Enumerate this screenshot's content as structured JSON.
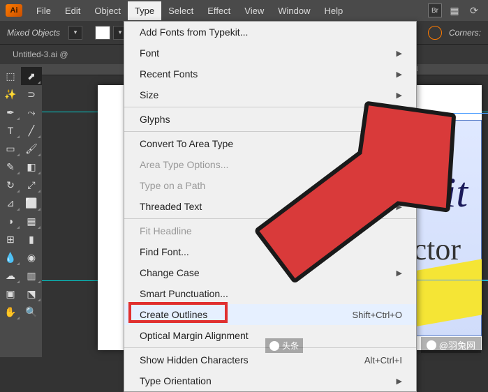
{
  "app": {
    "logo": "Ai"
  },
  "menubar": {
    "items": [
      "File",
      "Edit",
      "Object",
      "Type",
      "Select",
      "Effect",
      "View",
      "Window",
      "Help"
    ],
    "active_index": 3,
    "right": {
      "br": "Br"
    }
  },
  "optionsbar": {
    "label": "Mixed Objects",
    "corners": "Corners:"
  },
  "doctab": {
    "title": "Untitled-3.ai @"
  },
  "ruler": {
    "mark": "1/4"
  },
  "dropdown": {
    "items": [
      {
        "label": "Add Fonts from Typekit...",
        "enabled": true
      },
      {
        "label": "Font",
        "enabled": true,
        "submenu": true
      },
      {
        "label": "Recent Fonts",
        "enabled": true,
        "submenu": true
      },
      {
        "label": "Size",
        "enabled": true,
        "submenu": true
      },
      {
        "sep": true
      },
      {
        "label": "Glyphs",
        "enabled": true
      },
      {
        "sep": true
      },
      {
        "label": "Convert To Area Type",
        "enabled": true
      },
      {
        "label": "Area Type Options...",
        "enabled": false
      },
      {
        "label": "Type on a Path",
        "enabled": false,
        "submenu": true
      },
      {
        "label": "Threaded Text",
        "enabled": true,
        "submenu": true
      },
      {
        "sep": true
      },
      {
        "label": "Fit Headline",
        "enabled": false
      },
      {
        "label": "Find Font...",
        "enabled": true
      },
      {
        "label": "Change Case",
        "enabled": true,
        "submenu": true
      },
      {
        "label": "Smart Punctuation...",
        "enabled": true
      },
      {
        "label": "Create Outlines",
        "enabled": true,
        "shortcut": "Shift+Ctrl+O",
        "highlighted": true,
        "boxed": true
      },
      {
        "label": "Optical Margin Alignment",
        "enabled": true
      },
      {
        "sep": true
      },
      {
        "label": "Show Hidden Characters",
        "enabled": true,
        "shortcut": "Alt+Ctrl+I"
      },
      {
        "label": "Type Orientation",
        "enabled": true,
        "submenu": true
      }
    ]
  },
  "canvas": {
    "script_text": "mit",
    "serif_text": "ctor"
  },
  "watermark": {
    "left": "头条",
    "right": "@羽兔网"
  }
}
